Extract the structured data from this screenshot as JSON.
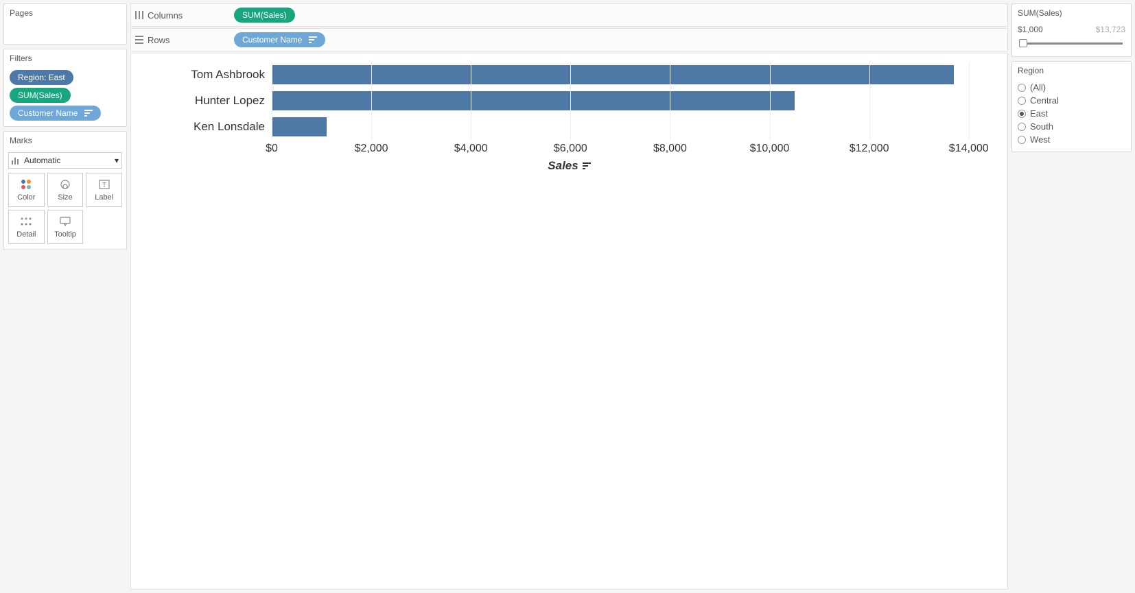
{
  "left": {
    "pages_title": "Pages",
    "filters_title": "Filters",
    "filters": [
      {
        "label": "Region: East",
        "color": "blue"
      },
      {
        "label": "SUM(Sales)",
        "color": "green"
      },
      {
        "label": "Customer Name",
        "color": "lightblue",
        "sort": true
      }
    ],
    "marks_title": "Marks",
    "marks_select": "Automatic",
    "mark_buttons": {
      "color": "Color",
      "size": "Size",
      "label": "Label",
      "detail": "Detail",
      "tooltip": "Tooltip"
    }
  },
  "shelves": {
    "columns_label": "Columns",
    "rows_label": "Rows",
    "columns_pill": "SUM(Sales)",
    "rows_pill": "Customer Name"
  },
  "chart_data": {
    "type": "bar",
    "categories": [
      "Tom Ashbrook",
      "Hunter Lopez",
      "Ken Lonsdale"
    ],
    "values": [
      13700,
      10500,
      1100
    ],
    "xlabel": "Sales",
    "xlim": [
      0,
      14500
    ],
    "ticks": [
      0,
      2000,
      4000,
      6000,
      8000,
      10000,
      12000,
      14000
    ],
    "tick_labels": [
      "$0",
      "$2,000",
      "$4,000",
      "$6,000",
      "$8,000",
      "$10,000",
      "$12,000",
      "$14,000"
    ],
    "bar_color": "#4e79a7"
  },
  "right": {
    "sum_sales": {
      "title": "SUM(Sales)",
      "min_label": "$1,000",
      "max_label": "$13,723"
    },
    "region": {
      "title": "Region",
      "options": [
        "(All)",
        "Central",
        "East",
        "South",
        "West"
      ],
      "selected": "East"
    }
  }
}
